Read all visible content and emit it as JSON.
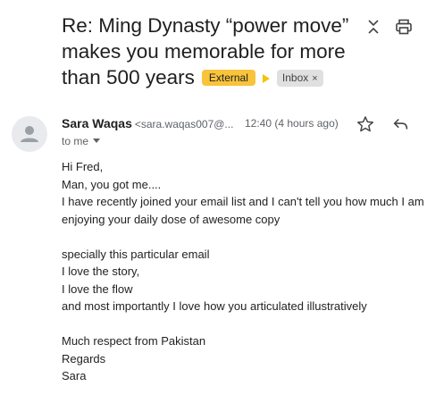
{
  "subject": {
    "text": "Re: Ming Dynasty “power move” makes you memorable for more than 500 years",
    "external_label": "External",
    "inbox_label": "Inbox",
    "inbox_remove": "×"
  },
  "toolbar": {
    "collapse_icon": "collapse-icon",
    "print_icon": "printer-icon"
  },
  "message": {
    "sender_name": "Sara Waqas",
    "sender_email": "<sara.waqas007@...",
    "time": "12:40 (4 hours ago)",
    "to": "to me",
    "star_icon": "star-icon",
    "reply_icon": "reply-icon",
    "avatar_icon": "person-icon"
  },
  "body_lines": [
    "Hi Fred,",
    "Man, you got me....",
    "I have recently joined your email list and I can't tell you how much I am",
    "enjoying your daily dose of awesome copy",
    "",
    "specially this particular email",
    "I love the story,",
    "I love the flow",
    "and most importantly I love how you articulated illustratively",
    "",
    "Much respect from Pakistan",
    "Regards",
    "Sara"
  ],
  "colors": {
    "external_badge": "#f9c33a",
    "importance_marker": "#f4c20d",
    "inbox_badge": "#e0e0e0"
  }
}
